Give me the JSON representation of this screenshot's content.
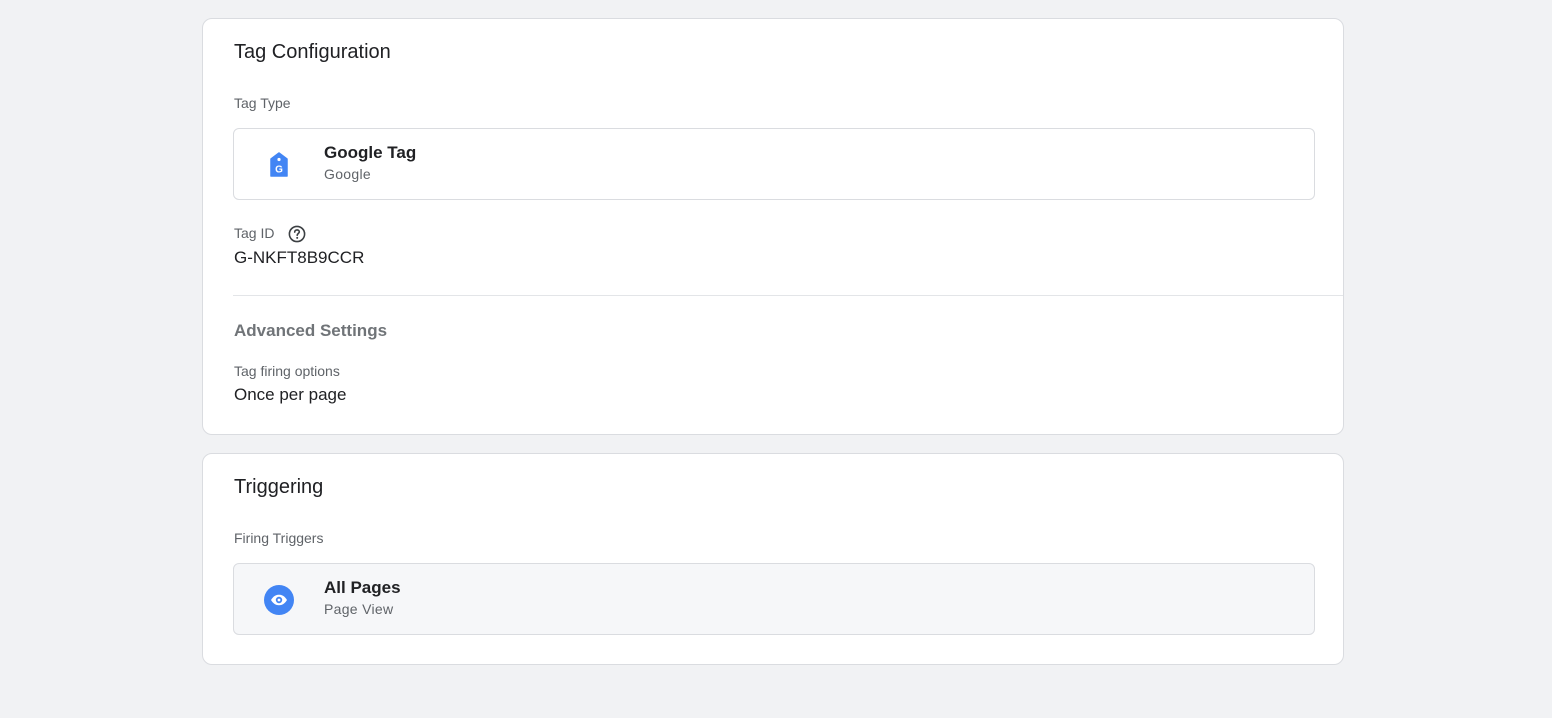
{
  "tag_configuration": {
    "title": "Tag Configuration",
    "tag_type_label": "Tag Type",
    "tag_type": {
      "name": "Google Tag",
      "vendor": "Google",
      "icon": "google-tag-icon"
    },
    "tag_id_label": "Tag ID",
    "tag_id_help_icon": "help-circle-icon",
    "tag_id_value": "G-NKFT8B9CCR",
    "advanced_settings_title": "Advanced Settings",
    "firing_options_label": "Tag firing options",
    "firing_options_value": "Once per page"
  },
  "triggering": {
    "title": "Triggering",
    "firing_triggers_label": "Firing Triggers",
    "trigger": {
      "name": "All Pages",
      "type": "Page View",
      "icon": "eye-icon"
    }
  },
  "colors": {
    "accent": "#4285f4",
    "page_background": "#f1f2f4",
    "card_border": "#dadce0"
  }
}
